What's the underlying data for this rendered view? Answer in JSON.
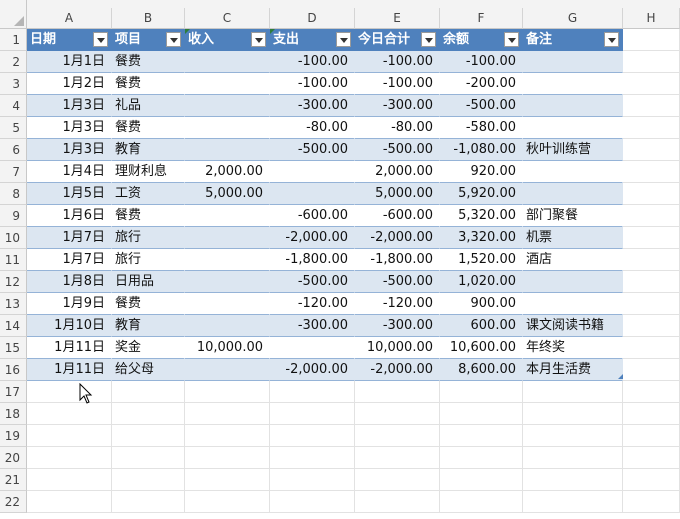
{
  "columns": [
    "A",
    "B",
    "C",
    "D",
    "E",
    "F",
    "G",
    "H"
  ],
  "row_numbers": [
    "1",
    "2",
    "3",
    "4",
    "5",
    "6",
    "7",
    "8",
    "9",
    "10",
    "11",
    "12",
    "13",
    "14",
    "15",
    "16",
    "17",
    "18",
    "19",
    "20",
    "21",
    "22"
  ],
  "table": {
    "headers": [
      "日期",
      "项目",
      "收入",
      "支出",
      "今日合计",
      "余额",
      "备注"
    ],
    "rows": [
      {
        "date": "1月1日",
        "item": "餐费",
        "income": "",
        "expense": "-100.00",
        "daily": "-100.00",
        "balance": "-100.00",
        "note": ""
      },
      {
        "date": "1月2日",
        "item": "餐费",
        "income": "",
        "expense": "-100.00",
        "daily": "-100.00",
        "balance": "-200.00",
        "note": ""
      },
      {
        "date": "1月3日",
        "item": "礼品",
        "income": "",
        "expense": "-300.00",
        "daily": "-300.00",
        "balance": "-500.00",
        "note": ""
      },
      {
        "date": "1月3日",
        "item": "餐费",
        "income": "",
        "expense": "-80.00",
        "daily": "-80.00",
        "balance": "-580.00",
        "note": ""
      },
      {
        "date": "1月3日",
        "item": "教育",
        "income": "",
        "expense": "-500.00",
        "daily": "-500.00",
        "balance": "-1,080.00",
        "note": "秋叶训练营"
      },
      {
        "date": "1月4日",
        "item": "理财利息",
        "income": "2,000.00",
        "expense": "",
        "daily": "2,000.00",
        "balance": "920.00",
        "note": ""
      },
      {
        "date": "1月5日",
        "item": "工资",
        "income": "5,000.00",
        "expense": "",
        "daily": "5,000.00",
        "balance": "5,920.00",
        "note": ""
      },
      {
        "date": "1月6日",
        "item": "餐费",
        "income": "",
        "expense": "-600.00",
        "daily": "-600.00",
        "balance": "5,320.00",
        "note": "部门聚餐"
      },
      {
        "date": "1月7日",
        "item": "旅行",
        "income": "",
        "expense": "-2,000.00",
        "daily": "-2,000.00",
        "balance": "3,320.00",
        "note": "机票"
      },
      {
        "date": "1月7日",
        "item": "旅行",
        "income": "",
        "expense": "-1,800.00",
        "daily": "-1,800.00",
        "balance": "1,520.00",
        "note": "酒店"
      },
      {
        "date": "1月8日",
        "item": "日用品",
        "income": "",
        "expense": "-500.00",
        "daily": "-500.00",
        "balance": "1,020.00",
        "note": ""
      },
      {
        "date": "1月9日",
        "item": "餐费",
        "income": "",
        "expense": "-120.00",
        "daily": "-120.00",
        "balance": "900.00",
        "note": ""
      },
      {
        "date": "1月10日",
        "item": "教育",
        "income": "",
        "expense": "-300.00",
        "daily": "-300.00",
        "balance": "600.00",
        "note": "课文阅读书籍"
      },
      {
        "date": "1月11日",
        "item": "奖金",
        "income": "10,000.00",
        "expense": "",
        "daily": "10,000.00",
        "balance": "10,600.00",
        "note": "年终奖"
      },
      {
        "date": "1月11日",
        "item": "给父母",
        "income": "",
        "expense": "-2,000.00",
        "daily": "-2,000.00",
        "balance": "8,600.00",
        "note": "本月生活费"
      }
    ]
  },
  "colors": {
    "header_bg": "#4f81bd",
    "band": "#dce6f1",
    "header_text": "#ffffff"
  },
  "icons": {
    "filter": "filter-dropdown-icon",
    "cursor": "mouse-pointer-icon",
    "corner": "select-all-icon"
  }
}
